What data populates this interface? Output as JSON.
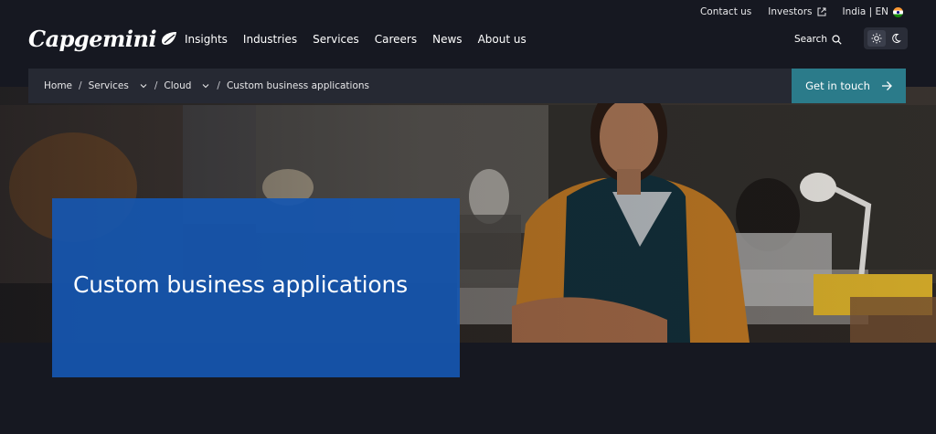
{
  "utility": {
    "contact": "Contact us",
    "investors": "Investors",
    "locale": "India | EN"
  },
  "brand": {
    "name": "Capgemini"
  },
  "nav": {
    "items": [
      "Insights",
      "Industries",
      "Services",
      "Careers",
      "News",
      "About us"
    ]
  },
  "search": {
    "label": "Search"
  },
  "breadcrumb": {
    "items": [
      "Home",
      "Services",
      "Cloud",
      "Custom business applications"
    ]
  },
  "cta": {
    "label": "Get in touch"
  },
  "hero": {
    "title": "Custom business applications"
  },
  "colors": {
    "background": "#161821",
    "breadcrumb_bg": "#262933",
    "cta_bg": "#2b7b8a",
    "title_card": "#1656af"
  }
}
